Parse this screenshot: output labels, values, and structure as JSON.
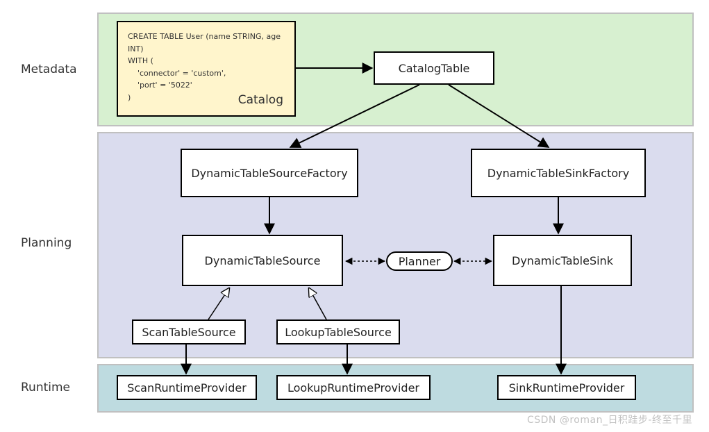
{
  "labels": {
    "metadata": "Metadata",
    "planning": "Planning",
    "runtime": "Runtime"
  },
  "catalog": {
    "line1": "CREATE TABLE User (name STRING, age INT)",
    "line2": "WITH (",
    "line3": "    'connector' = 'custom',",
    "line4": "    'port' = '5022'",
    "line5": ")",
    "title": "Catalog"
  },
  "nodes": {
    "catalogTable": "CatalogTable",
    "sourceFactory": "DynamicTableSourceFactory",
    "sinkFactory": "DynamicTableSinkFactory",
    "tableSource": "DynamicTableSource",
    "tableSink": "DynamicTableSink",
    "planner": "Planner",
    "scanTableSource": "ScanTableSource",
    "lookupTableSource": "LookupTableSource",
    "scanRuntime": "ScanRuntimeProvider",
    "lookupRuntime": "LookupRuntimeProvider",
    "sinkRuntime": "SinkRuntimeProvider"
  },
  "watermark": "CSDN @roman_日积跬步-终至千里"
}
